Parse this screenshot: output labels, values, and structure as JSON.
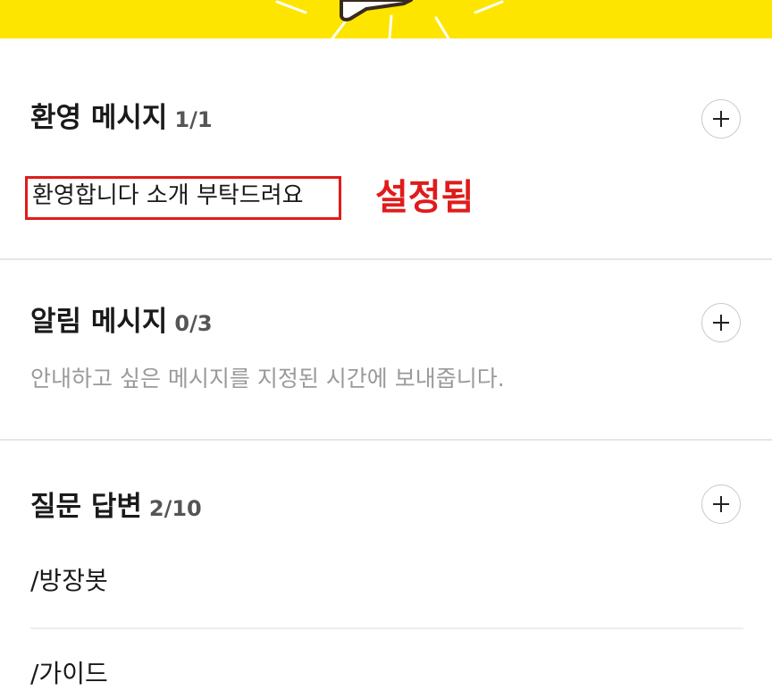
{
  "banner": {
    "color": "#FEE500"
  },
  "sections": {
    "welcome": {
      "title": "환영 메시지",
      "count": "1/1",
      "message": "환영합니다 소개 부탁드려요",
      "annotation": "설정됨",
      "add_icon": "plus-icon"
    },
    "notice": {
      "title": "알림 메시지",
      "count": "0/3",
      "description": "안내하고 싶은 메시지를 지정된 시간에 보내줍니다.",
      "add_icon": "plus-icon"
    },
    "qa": {
      "title": "질문 답변",
      "count": "2/10",
      "items": [
        "/방장봇",
        "/가이드"
      ],
      "add_icon": "plus-icon"
    }
  },
  "colors": {
    "highlight_red": "#e01b1b",
    "muted_text": "#9a9a9a"
  }
}
